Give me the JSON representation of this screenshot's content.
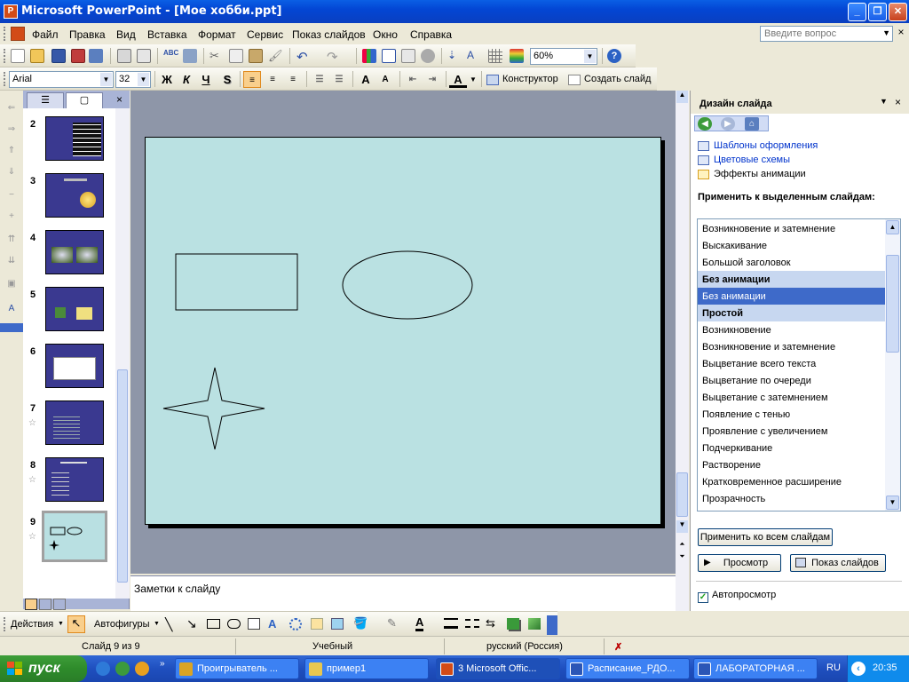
{
  "window": {
    "title": "Microsoft PowerPoint - [Мое хобби.ppt]",
    "app_icon_letter": "P",
    "minimize": "_",
    "maximize": "❐",
    "close": "✕"
  },
  "menubar": {
    "items": [
      "Файл",
      "Правка",
      "Вид",
      "Вставка",
      "Формат",
      "Сервис",
      "Показ слайдов",
      "Окно",
      "Справка"
    ],
    "question_placeholder": "Введите вопрос",
    "doc_close": "×"
  },
  "standard_toolbar": {
    "zoom": "60%"
  },
  "formatting_toolbar": {
    "font": "Arial",
    "size": "32",
    "bold": "Ж",
    "italic": "К",
    "underline": "Ч",
    "shadow": "S",
    "designer": "Конструктор",
    "new_slide": "Создать слайд"
  },
  "outline_pane": {
    "close": "×",
    "slides": [
      {
        "number": "2",
        "star": ""
      },
      {
        "number": "3",
        "star": ""
      },
      {
        "number": "4",
        "star": ""
      },
      {
        "number": "5",
        "star": ""
      },
      {
        "number": "6",
        "star": ""
      },
      {
        "number": "7",
        "star": "☆"
      },
      {
        "number": "8",
        "star": "☆"
      },
      {
        "number": "9",
        "star": "☆"
      }
    ]
  },
  "notes": {
    "placeholder": "Заметки к слайду"
  },
  "task_pane": {
    "title": "Дизайн слайда",
    "links": [
      "Шаблоны оформления",
      "Цветовые схемы",
      "Эффекты анимации"
    ],
    "apply_label": "Применить к выделенным слайдам:",
    "animations": [
      {
        "label": "Возникновение и затемнение",
        "kind": "item"
      },
      {
        "label": "Выскакивание",
        "kind": "item"
      },
      {
        "label": "Большой заголовок",
        "kind": "item"
      },
      {
        "label": "Без анимации",
        "kind": "header"
      },
      {
        "label": "Без анимации",
        "kind": "selected"
      },
      {
        "label": "Простой",
        "kind": "header"
      },
      {
        "label": "Возникновение",
        "kind": "item"
      },
      {
        "label": "Возникновение и затемнение",
        "kind": "item"
      },
      {
        "label": "Выцветание всего текста",
        "kind": "item"
      },
      {
        "label": "Выцветание по очереди",
        "kind": "item"
      },
      {
        "label": "Выцветание с затемнением",
        "kind": "item"
      },
      {
        "label": "Появление с тенью",
        "kind": "item"
      },
      {
        "label": "Проявление с увеличением",
        "kind": "item"
      },
      {
        "label": "Подчеркивание",
        "kind": "item"
      },
      {
        "label": "Растворение",
        "kind": "item"
      },
      {
        "label": "Кратковременное расширение",
        "kind": "item"
      },
      {
        "label": "Прозрачность",
        "kind": "item"
      }
    ],
    "apply_all": "Применить ко всем слайдам",
    "preview": "Просмотр",
    "slideshow": "Показ слайдов",
    "autopreview": "Автопросмотр",
    "autopreview_checked": true
  },
  "drawing_toolbar": {
    "actions": "Действия",
    "autoshapes": "Автофигуры"
  },
  "status_bar": {
    "slide": "Слайд 9 из 9",
    "design": "Учебный",
    "language": "русский (Россия)"
  },
  "taskbar": {
    "start": "пуск",
    "tasks": [
      {
        "label": "Проигрыватель ...",
        "color": "#d9a425"
      },
      {
        "label": "пример1",
        "color": "#e8c750"
      },
      {
        "label": "3 Microsoft Offic...",
        "color": "#d24b17"
      },
      {
        "label": "Расписание_РДО...",
        "color": "#2b56b6"
      },
      {
        "label": "ЛАБОРАТОРНАЯ ...",
        "color": "#2b56b6"
      }
    ],
    "lang": "RU",
    "time": "20:35"
  },
  "colors": {
    "slide_bg": "#bae1e2",
    "thumb_bg": "#3a3990",
    "selection": "#3e6ac9"
  }
}
